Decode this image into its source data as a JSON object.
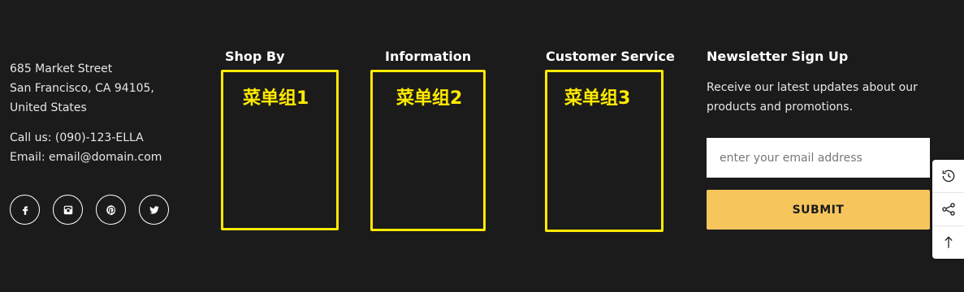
{
  "contact": {
    "address_line1": "685 Market Street",
    "address_line2": "San Francisco, CA 94105,",
    "address_line3": "United States",
    "phone": "Call us: (090)-123-ELLA",
    "email": "Email: email@domain.com"
  },
  "socials": [
    {
      "icon": "facebook-icon"
    },
    {
      "icon": "instagram-icon"
    },
    {
      "icon": "pinterest-icon"
    },
    {
      "icon": "twitter-icon"
    }
  ],
  "menus": [
    {
      "title": "Shop By",
      "placeholder": "菜单组1"
    },
    {
      "title": "Information",
      "placeholder": "菜单组2"
    },
    {
      "title": "Customer Service",
      "placeholder": "菜单组3"
    }
  ],
  "newsletter": {
    "title": "Newsletter Sign Up",
    "description": "Receive our latest updates about our products and promotions.",
    "email_placeholder": "enter your email address",
    "submit_label": "SUBMIT"
  },
  "side_tools": [
    {
      "icon": "history-icon"
    },
    {
      "icon": "share-icon"
    },
    {
      "icon": "arrow-up-icon"
    }
  ],
  "colors": {
    "background": "#1b1b1b",
    "highlight": "#ffea00",
    "submit_button": "#f6c55c"
  }
}
